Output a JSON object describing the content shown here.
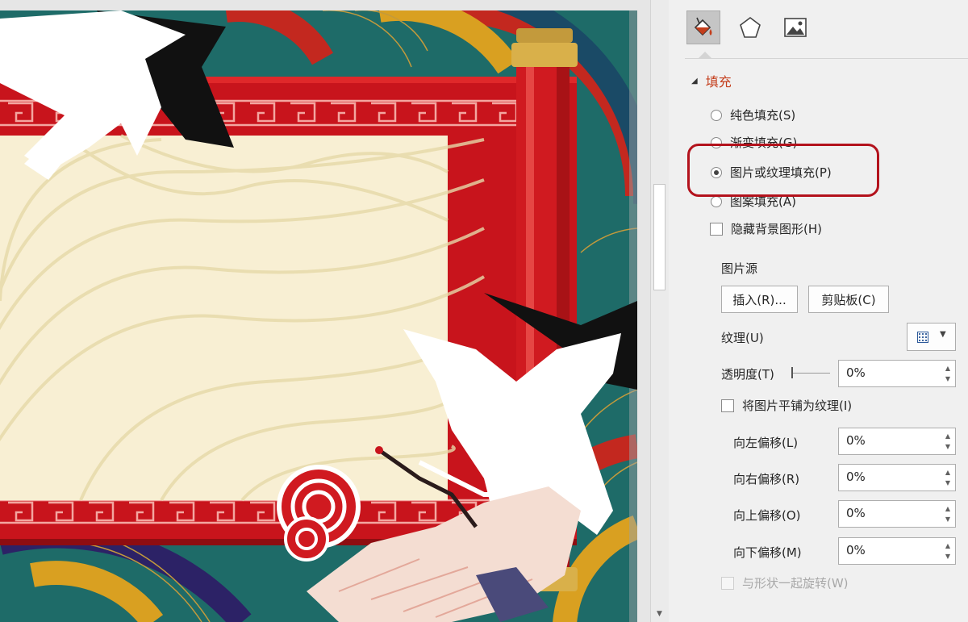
{
  "pane": {
    "tabs": [
      {
        "name": "fill-line",
        "icon": "paint-bucket-icon",
        "selected": true
      },
      {
        "name": "effects",
        "icon": "pentagon-icon",
        "selected": false
      },
      {
        "name": "picture",
        "icon": "picture-icon",
        "selected": false
      }
    ],
    "section_title": "填充",
    "fill_options": {
      "solid": "纯色填充(S)",
      "gradient": "渐变填充(G)",
      "picture_texture": "图片或纹理填充(P)",
      "pattern": "图案填充(A)",
      "selected": "picture_texture"
    },
    "hide_background": "隐藏背景图形(H)",
    "picture_source_label": "图片源",
    "insert_button": "插入(R)...",
    "clipboard_button": "剪贴板(C)",
    "texture_label": "纹理(U)",
    "transparency_label": "透明度(T)",
    "transparency_value": "0%",
    "tile_label": "将图片平铺为纹理(I)",
    "offset_left_label": "向左偏移(L)",
    "offset_left_value": "0%",
    "offset_right_label": "向右偏移(R)",
    "offset_right_value": "0%",
    "offset_top_label": "向上偏移(O)",
    "offset_top_value": "0%",
    "offset_bottom_label": "向下偏移(M)",
    "offset_bottom_value": "0%",
    "rotate_with_shape_label": "与形状一起旋转(W)"
  },
  "colors": {
    "accent": "#c43e1c",
    "highlight": "#b3121c",
    "scroll_red": "#c8141c",
    "paper": "#f8efd3",
    "gold": "#c39a3c"
  }
}
